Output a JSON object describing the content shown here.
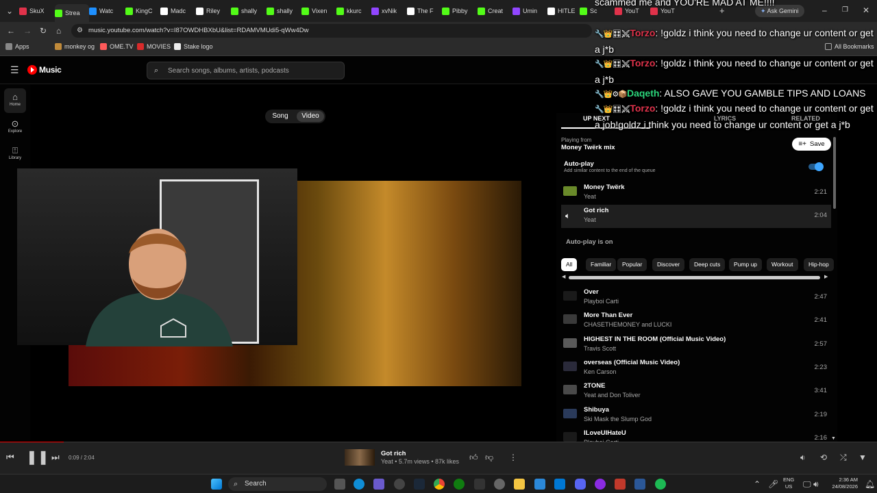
{
  "browser": {
    "tabs": [
      {
        "label": "SkuX",
        "color": "#e0324a"
      },
      {
        "label": "Strea",
        "color": "#53fc18"
      },
      {
        "label": "Watc",
        "color": "#1e90ff"
      },
      {
        "label": "KingC",
        "color": "#53fc18"
      },
      {
        "label": "Madc",
        "color": "#ffffff"
      },
      {
        "label": "Riley",
        "color": "#ffffff"
      },
      {
        "label": "shally",
        "color": "#53fc18"
      },
      {
        "label": "shally",
        "color": "#53fc18"
      },
      {
        "label": "Vixen",
        "color": "#53fc18"
      },
      {
        "label": "kkurc",
        "color": "#53fc18"
      },
      {
        "label": "xvNik",
        "color": "#9146ff"
      },
      {
        "label": "The F",
        "color": "#ffffff"
      },
      {
        "label": "Pibby",
        "color": "#53fc18"
      },
      {
        "label": "Creat",
        "color": "#53fc18"
      },
      {
        "label": "Umin",
        "color": "#9146ff"
      },
      {
        "label": "HITLE",
        "color": "#ffffff"
      },
      {
        "label": "Sc",
        "color": "#53fc18"
      },
      {
        "label": "YouT",
        "color": "#e0324a"
      },
      {
        "label": "YouT",
        "color": "#e0324a"
      }
    ],
    "new_tab": "+",
    "ask_gemini": "Ask Gemini",
    "url": "music.youtube.com/watch?v=I87OWDHBXbU&list=RDAMVMUdi5-qWw4Dw",
    "bookmarks": [
      {
        "label": "Apps",
        "color": "#888888"
      },
      {
        "label": "monkey og",
        "color": "#c08a3a"
      },
      {
        "label": "OME.TV",
        "color": "#ff5a5a"
      },
      {
        "label": "MOVIES",
        "color": "#d92b2b"
      },
      {
        "label": "Stake logo",
        "color": "#eeeeee"
      }
    ],
    "all_bookmarks": "All Bookmarks"
  },
  "yt": {
    "logo": "Music",
    "search_placeholder": "Search songs, albums, artists, podcasts",
    "nav": [
      {
        "label": "Home",
        "icon": "home-icon"
      },
      {
        "label": "Explore",
        "icon": "compass-icon"
      },
      {
        "label": "Library",
        "icon": "library-icon"
      }
    ],
    "toggle": {
      "song": "Song",
      "video": "Video"
    }
  },
  "queue": {
    "tabs": [
      "UP NEXT",
      "LYRICS",
      "RELATED"
    ],
    "playing_from_label": "Playing from",
    "playing_from": "Money Twërk mix",
    "save": "Save",
    "autoplay_title": "Auto-play",
    "autoplay_desc": "Add similar content to the end of the queue",
    "current": [
      {
        "title": "Money Twërk",
        "artist": "Yeat",
        "duration": "2:21"
      },
      {
        "title": "Got rich",
        "artist": "Yeat",
        "duration": "2:04"
      }
    ],
    "autoplay_on": "Auto-play is on",
    "chips": [
      "All",
      "Familiar",
      "Popular",
      "Discover",
      "Deep cuts",
      "Pump up",
      "Workout",
      "Hip-hop"
    ],
    "items": [
      {
        "title": "Over",
        "artist": "Playboi Carti",
        "duration": "2:47"
      },
      {
        "title": "More Than Ever",
        "artist": "CHASETHEMONEY and LUCKI",
        "duration": "2:41"
      },
      {
        "title": "HIGHEST IN THE ROOM (Official Music Video)",
        "artist": "Travis Scott",
        "duration": "2:57"
      },
      {
        "title": "overseas (Official Music Video)",
        "artist": "Ken Carson",
        "duration": "2:23"
      },
      {
        "title": "2TONE",
        "artist": "Yeat and Don Toliver",
        "duration": "3:41"
      },
      {
        "title": "Shibuya",
        "artist": "Ski Mask the Slump God",
        "duration": "2:19"
      },
      {
        "title": "ILoveUIHateU",
        "artist": "Playboi Carti",
        "duration": "2:16"
      }
    ]
  },
  "chat": [
    {
      "text": "scammed me and YOU'RE MAD AT ME!!!!",
      "name": "",
      "emotes": "",
      "green": false
    },
    {
      "text": ": !goldz i think you need to change ur content or get a j*b",
      "name": "Torzo",
      "emotes": "🔧👑🎛⚔",
      "green": false
    },
    {
      "text": ": !goldz i think you need to change ur content or get a j*b",
      "name": "Torzo",
      "emotes": "🔧👑🎛⚔",
      "green": false
    },
    {
      "text": ": ALSO GAVE YOU GAMBLE TIPS AND LOANS",
      "name": "Daqeth",
      "emotes": "🔧👑⚙📦",
      "green": true
    },
    {
      "text": ": !goldz i think you need to change ur content or get a job!goldz i think you need to change ur content or get a j*b",
      "name": "Torzo",
      "emotes": "🔧👑🎛⚔",
      "green": false
    }
  ],
  "player": {
    "time": "0:09 / 2:04",
    "progress": 0.073,
    "title": "Got rich",
    "meta": "Yeat • 5.7m views • 87k likes"
  },
  "taskbar": {
    "search": "Search",
    "lang": "ENG",
    "region": "US",
    "time": "2:36 AM",
    "date": "24/08/2026"
  }
}
